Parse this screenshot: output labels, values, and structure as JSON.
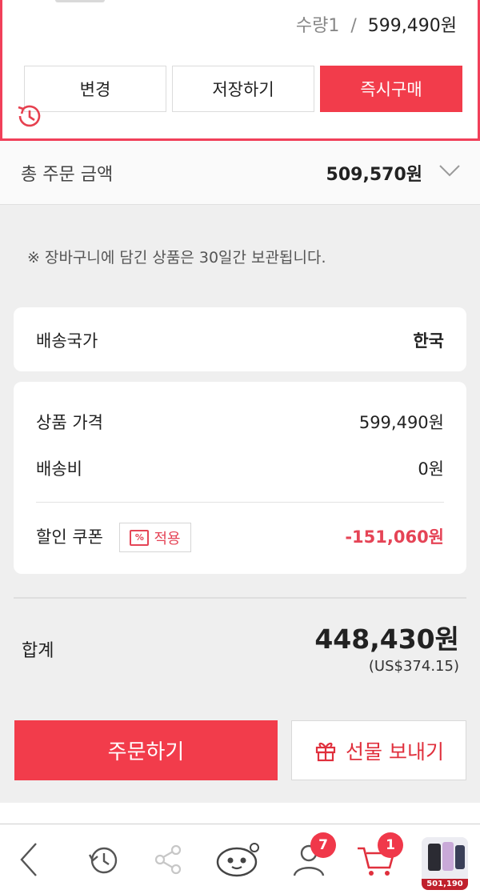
{
  "product": {
    "quantity_label": "수량1",
    "separator": "/",
    "price": "599,490원",
    "buttons": {
      "change": "변경",
      "save": "저장하기",
      "buy_now": "즉시구매"
    }
  },
  "total_order": {
    "label": "총 주문 금액",
    "amount": "509,570원"
  },
  "notice": "※ 장바구니에 담긴 상품은 30일간 보관됩니다.",
  "shipping": {
    "label": "배송국가",
    "value": "한국"
  },
  "price_details": {
    "item_price_label": "상품 가격",
    "item_price": "599,490원",
    "shipping_fee_label": "배송비",
    "shipping_fee": "0원",
    "coupon_label": "할인 쿠폰",
    "coupon_button": "적용",
    "coupon_icon_text": "%",
    "discount": "-151,060원"
  },
  "summary": {
    "label": "합계",
    "amount": "448,430원",
    "usd": "(US$374.15)"
  },
  "actions": {
    "order": "주문하기",
    "gift": "선물 보내기"
  },
  "bottom_nav": {
    "back_icon": "chevron-left-icon",
    "history_icon": "history-icon",
    "share_icon": "share-icon",
    "mascot_icon": "mascot-icon",
    "profile_badge": "7",
    "cart_badge": "1",
    "thumb_price": "501,190"
  },
  "colors": {
    "accent": "#f23c4b",
    "discount": "#e54456",
    "border_highlight": "#f1405a"
  }
}
